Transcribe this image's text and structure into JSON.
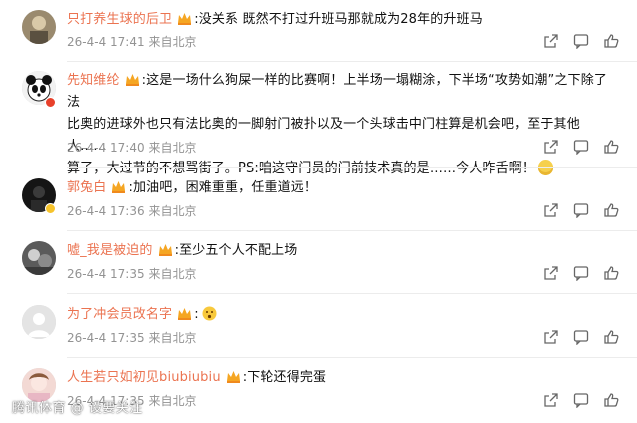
{
  "colors": {
    "username": "#eb7350",
    "meta": "#939393",
    "text": "#111111",
    "divider": "#ececec"
  },
  "actions": {
    "share_icon": "share-icon",
    "comment_icon": "comment-icon",
    "like_icon": "like-icon"
  },
  "comments": [
    {
      "username": "只打养生球的后卫",
      "text": ":没关系 既然不打过升班马那就成为28年的升班马",
      "time": "26-4-4 17:41",
      "location": "来自北京"
    },
    {
      "username": "先知维纶",
      "text_line1": ":这是一场什么狗屎一样的比赛啊！上半场一塌糊涂，下半场“攻势如潮”之下除了法",
      "text_line2": "比奥的进球外也只有法比奥的一脚射门被扑以及一个头球击中门柱算是机会吧，至于其他人……",
      "text_line3": "算了，大过节的不想骂街了。PS:咱这守门员的门前技术真的是……今人咋舌啊！",
      "time": "26-4-4 17:40",
      "location": "来自北京"
    },
    {
      "username": "郭兔白",
      "text": ":加油吧，困难重重，任重道远！",
      "time": "26-4-4 17:36",
      "location": "来自北京"
    },
    {
      "username": "嘘_我是被迫的",
      "text": ":至少五个人不配上场",
      "time": "26-4-4 17:35",
      "location": "来自北京"
    },
    {
      "username": "为了冲会员改名字",
      "text": ":",
      "time": "26-4-4 17:35",
      "location": "来自北京"
    },
    {
      "username": "人生若只如初见biubiubiu",
      "text": ":下轮还得完蛋",
      "time": "26-4-4 17:35",
      "location": "来自北京"
    }
  ],
  "watermark": "腾讯体育 @ 设要关注"
}
